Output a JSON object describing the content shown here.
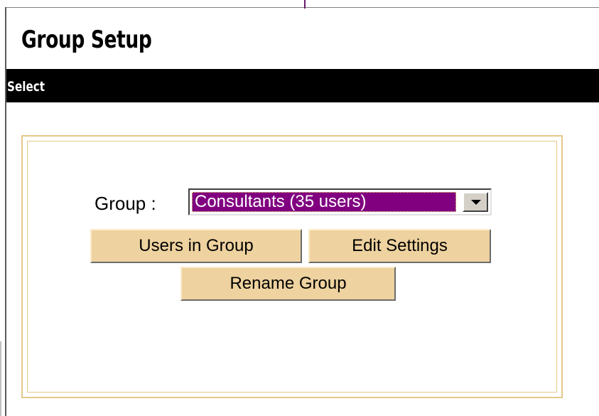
{
  "header": {
    "title": "Group Setup"
  },
  "section": {
    "label": "Select"
  },
  "group_select": {
    "label": "Group :",
    "selected": "Consultants (35 users)"
  },
  "buttons": {
    "users_in_group": "Users in Group",
    "edit_settings": "Edit Settings",
    "rename_group": "Rename Group"
  },
  "colors": {
    "header_bar": "#000000",
    "selection_highlight": "#800080",
    "button_face": "#eed29f",
    "panel_border": "#e3c98a"
  }
}
